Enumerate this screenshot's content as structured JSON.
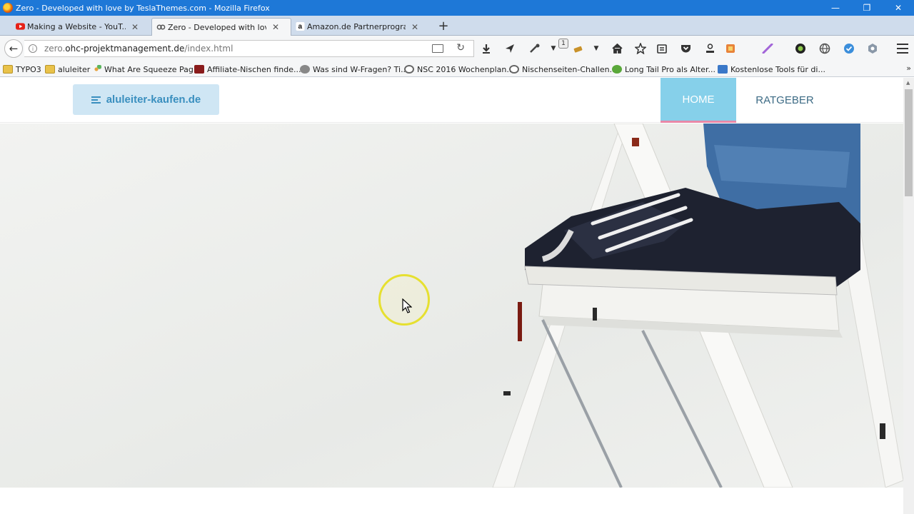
{
  "window": {
    "title": "Zero - Developed with love by TeslaThemes.com - Mozilla Firefox",
    "controls": {
      "minimize": "—",
      "restore": "❐",
      "close": "✕"
    }
  },
  "tabs": [
    {
      "label": "Making a Website - YouT...",
      "icon": "youtube-icon",
      "close": "✕"
    },
    {
      "label": "Zero - Developed with lov...",
      "icon": "link-icon",
      "close": "✕",
      "active": true
    },
    {
      "label": "Amazon.de Partnerprogra...",
      "icon": "amazon-icon",
      "close": "✕"
    }
  ],
  "newtab_label": "+",
  "navbar": {
    "back_label": "←",
    "url_prefix": "zero.",
    "url_domain": "ohc-projektmanagement.de",
    "url_path": "/index.html",
    "info_label": "i",
    "reload_label": "↻",
    "badge_count": "1"
  },
  "bookmarks": [
    {
      "label": "TYPO3",
      "icon": "folder-icon"
    },
    {
      "label": "aluleiter",
      "icon": "folder-icon"
    },
    {
      "label": "What Are Squeeze Pag...",
      "icon": "dots-icon"
    },
    {
      "label": "Affiliate-Nischen finde...",
      "icon": "affiliate-icon"
    },
    {
      "label": "Was sind W-Fragen? Ti...",
      "icon": "globe-icon"
    },
    {
      "label": "NSC 2016 Wochenplan...",
      "icon": "site-icon"
    },
    {
      "label": "Nischenseiten-Challen...",
      "icon": "site-icon"
    },
    {
      "label": "Long Tail Pro als Alter...",
      "icon": "longtail-icon"
    },
    {
      "label": "Kostenlose Tools für di...",
      "icon": "tools-icon"
    }
  ],
  "bookmarks_more": "»",
  "site": {
    "logo_text": "aluleiter-kaufen.de",
    "nav": [
      {
        "label": "HOME",
        "active": true
      },
      {
        "label": "RATGEBER"
      }
    ]
  },
  "colors": {
    "titlebar": "#1e78d7",
    "logo_bg": "#cfe6f4",
    "logo_text": "#3a8fbf",
    "nav_active_bg": "#86d0ea",
    "nav_active_underline": "#e889a8",
    "nav_text": "#3d6b85",
    "cursor_highlight": "#e6e030"
  }
}
